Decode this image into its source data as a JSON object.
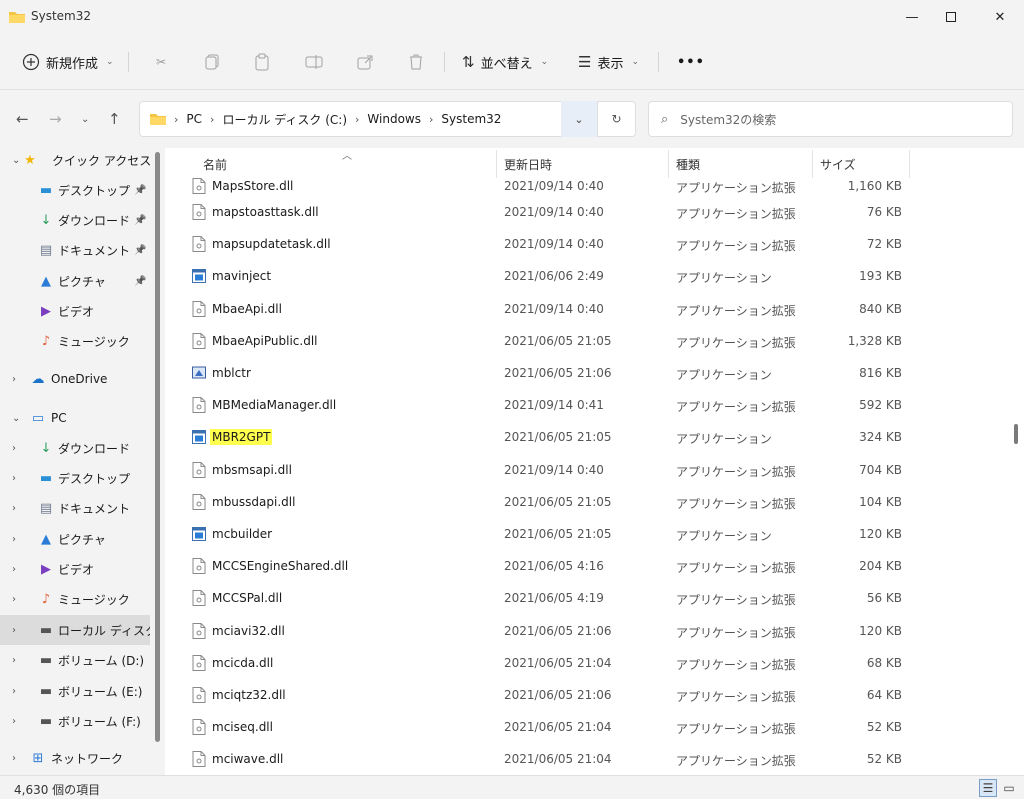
{
  "window": {
    "title": "System32"
  },
  "toolbar": {
    "new_label": "新規作成",
    "sort_label": "並べ替え",
    "view_label": "表示",
    "more_label": "•••"
  },
  "address": {
    "breadcrumbs": [
      "PC",
      "ローカル ディスク (C:)",
      "Windows",
      "System32"
    ],
    "search_placeholder": "System32の検索"
  },
  "sidebar": {
    "items": [
      {
        "label": "クイック アクセス",
        "icon": "star-icon",
        "pinned": false
      },
      {
        "label": "デスクトップ",
        "icon": "desktop-icon",
        "pinned": true
      },
      {
        "label": "ダウンロード",
        "icon": "download-icon",
        "pinned": true
      },
      {
        "label": "ドキュメント",
        "icon": "document-icon",
        "pinned": true
      },
      {
        "label": "ピクチャ",
        "icon": "pictures-icon",
        "pinned": true
      },
      {
        "label": "ビデオ",
        "icon": "video-icon",
        "pinned": false
      },
      {
        "label": "ミュージック",
        "icon": "music-icon",
        "pinned": false
      },
      {
        "label": "OneDrive",
        "icon": "cloud-icon",
        "pinned": false
      },
      {
        "label": "PC",
        "icon": "pc-icon",
        "pinned": false
      },
      {
        "label": "ダウンロード",
        "icon": "download-icon",
        "pinned": false
      },
      {
        "label": "デスクトップ",
        "icon": "desktop-icon",
        "pinned": false
      },
      {
        "label": "ドキュメント",
        "icon": "document-icon",
        "pinned": false
      },
      {
        "label": "ピクチャ",
        "icon": "pictures-icon",
        "pinned": false
      },
      {
        "label": "ビデオ",
        "icon": "video-icon",
        "pinned": false
      },
      {
        "label": "ミュージック",
        "icon": "music-icon",
        "pinned": false
      },
      {
        "label": "ローカル ディスク (",
        "icon": "drive-icon",
        "pinned": false
      },
      {
        "label": "ボリューム (D:)",
        "icon": "drive-icon",
        "pinned": false
      },
      {
        "label": "ボリューム (E:)",
        "icon": "drive-icon",
        "pinned": false
      },
      {
        "label": "ボリューム (F:)",
        "icon": "drive-icon",
        "pinned": false
      },
      {
        "label": "ネットワーク",
        "icon": "network-icon",
        "pinned": false
      }
    ]
  },
  "columns": {
    "name": "名前",
    "date": "更新日時",
    "type": "種類",
    "size": "サイズ"
  },
  "files": [
    {
      "name": "MapsStore.dll",
      "date": "2021/09/14 0:40",
      "type": "アプリケーション拡張",
      "size": "1,160 KB",
      "kind": "dll"
    },
    {
      "name": "mapstoasttask.dll",
      "date": "2021/09/14 0:40",
      "type": "アプリケーション拡張",
      "size": "76 KB",
      "kind": "dll"
    },
    {
      "name": "mapsupdatetask.dll",
      "date": "2021/09/14 0:40",
      "type": "アプリケーション拡張",
      "size": "72 KB",
      "kind": "dll"
    },
    {
      "name": "mavinject",
      "date": "2021/06/06 2:49",
      "type": "アプリケーション",
      "size": "193 KB",
      "kind": "exe"
    },
    {
      "name": "MbaeApi.dll",
      "date": "2021/09/14 0:40",
      "type": "アプリケーション拡張",
      "size": "840 KB",
      "kind": "dll"
    },
    {
      "name": "MbaeApiPublic.dll",
      "date": "2021/06/05 21:05",
      "type": "アプリケーション拡張",
      "size": "1,328 KB",
      "kind": "dll"
    },
    {
      "name": "mblctr",
      "date": "2021/06/05 21:06",
      "type": "アプリケーション",
      "size": "816 KB",
      "kind": "mblctr"
    },
    {
      "name": "MBMediaManager.dll",
      "date": "2021/09/14 0:41",
      "type": "アプリケーション拡張",
      "size": "592 KB",
      "kind": "dll"
    },
    {
      "name": "MBR2GPT",
      "date": "2021/06/05 21:05",
      "type": "アプリケーション",
      "size": "324 KB",
      "kind": "exe",
      "highlight": true
    },
    {
      "name": "mbsmsapi.dll",
      "date": "2021/09/14 0:40",
      "type": "アプリケーション拡張",
      "size": "704 KB",
      "kind": "dll"
    },
    {
      "name": "mbussdapi.dll",
      "date": "2021/06/05 21:05",
      "type": "アプリケーション拡張",
      "size": "104 KB",
      "kind": "dll"
    },
    {
      "name": "mcbuilder",
      "date": "2021/06/05 21:05",
      "type": "アプリケーション",
      "size": "120 KB",
      "kind": "exe"
    },
    {
      "name": "MCCSEngineShared.dll",
      "date": "2021/06/05 4:16",
      "type": "アプリケーション拡張",
      "size": "204 KB",
      "kind": "dll"
    },
    {
      "name": "MCCSPal.dll",
      "date": "2021/06/05 4:19",
      "type": "アプリケーション拡張",
      "size": "56 KB",
      "kind": "dll"
    },
    {
      "name": "mciavi32.dll",
      "date": "2021/06/05 21:06",
      "type": "アプリケーション拡張",
      "size": "120 KB",
      "kind": "dll"
    },
    {
      "name": "mcicda.dll",
      "date": "2021/06/05 21:04",
      "type": "アプリケーション拡張",
      "size": "68 KB",
      "kind": "dll"
    },
    {
      "name": "mciqtz32.dll",
      "date": "2021/06/05 21:06",
      "type": "アプリケーション拡張",
      "size": "64 KB",
      "kind": "dll"
    },
    {
      "name": "mciseq.dll",
      "date": "2021/06/05 21:04",
      "type": "アプリケーション拡張",
      "size": "52 KB",
      "kind": "dll"
    },
    {
      "name": "mciwave.dll",
      "date": "2021/06/05 21:04",
      "type": "アプリケーション拡張",
      "size": "52 KB",
      "kind": "dll"
    }
  ],
  "status": {
    "item_count": "4,630 個の項目"
  },
  "colors": {
    "highlight": "#ffff4d",
    "selected_bg": "#dcdcdc",
    "accent": "#1a73c8"
  }
}
